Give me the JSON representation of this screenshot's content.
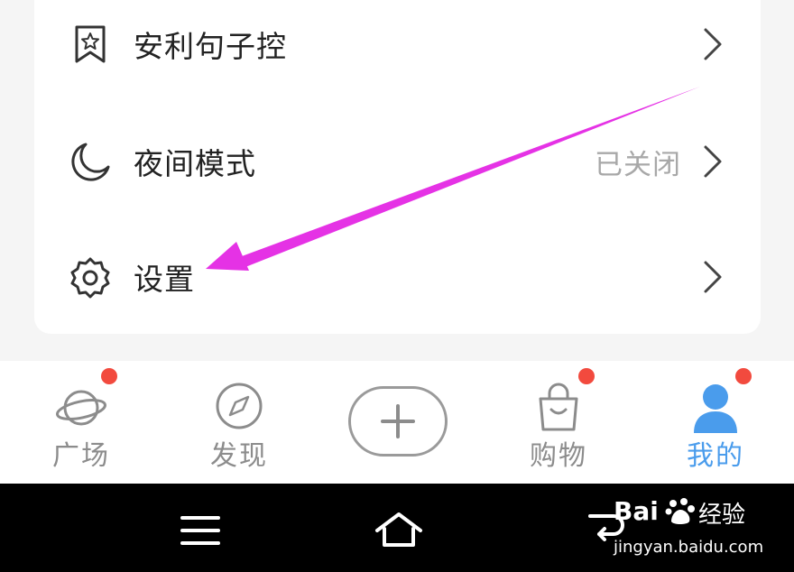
{
  "menu": {
    "items": [
      {
        "label": "安利句子控",
        "icon": "bookmark-star-icon",
        "value": ""
      },
      {
        "label": "夜间模式",
        "icon": "moon-icon",
        "value": "已关闭"
      },
      {
        "label": "设置",
        "icon": "gear-icon",
        "value": ""
      }
    ]
  },
  "bottom_nav": {
    "items": [
      {
        "label": "广场",
        "icon": "planet-icon",
        "badge": true
      },
      {
        "label": "发现",
        "icon": "compass-icon",
        "badge": false
      },
      {
        "label": "购物",
        "icon": "shopping-bag-icon",
        "badge": true
      },
      {
        "label": "我的",
        "icon": "user-icon",
        "badge": true,
        "active": true
      }
    ],
    "add_icon": "plus-icon"
  },
  "watermark": {
    "brand_left": "Bai",
    "brand_right": "经验",
    "url": "jingyan.baidu.com"
  },
  "colors": {
    "arrow": "#e532e5",
    "active": "#4a9cec",
    "badge": "#f24a3e"
  }
}
